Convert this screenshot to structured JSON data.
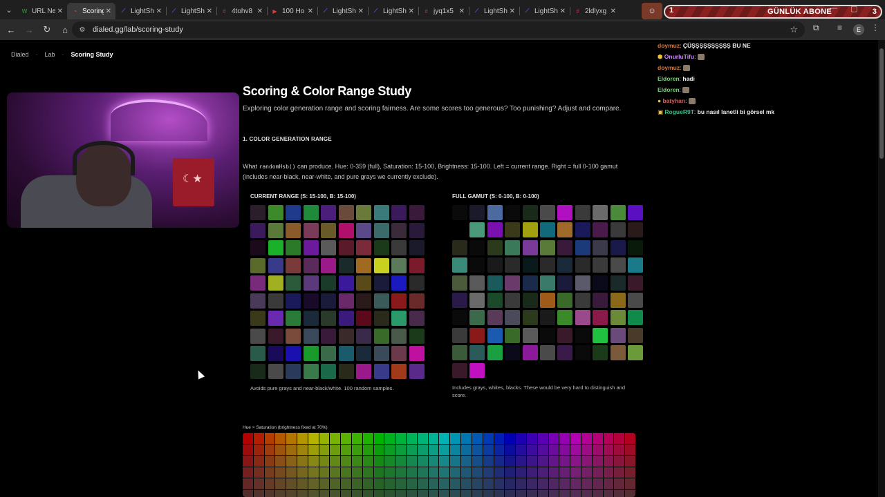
{
  "browser": {
    "tabs": [
      {
        "title": "URL Ne",
        "fav": "W",
        "fav_color": "#2e7d32",
        "active": false
      },
      {
        "title": "Scoring",
        "fav": "◔",
        "fav_color": "#e44d26",
        "active": true
      },
      {
        "title": "LightSh",
        "fav": "⟋",
        "fav_color": "#7b3ff2",
        "active": false
      },
      {
        "title": "LightSh",
        "fav": "⟋",
        "fav_color": "#7b3ff2",
        "active": false
      },
      {
        "title": "4tohv8",
        "fav": "#",
        "fav_color": "#c2185b",
        "active": false
      },
      {
        "title": "100 Ho",
        "fav": "▶",
        "fav_color": "#e53935",
        "active": false
      },
      {
        "title": "LightSh",
        "fav": "⟋",
        "fav_color": "#7b3ff2",
        "active": false
      },
      {
        "title": "LightSh",
        "fav": "⟋",
        "fav_color": "#7b3ff2",
        "active": false
      },
      {
        "title": "jyq1x5",
        "fav": "#",
        "fav_color": "#c2185b",
        "active": false
      },
      {
        "title": "LightSh",
        "fav": "⟋",
        "fav_color": "#7b3ff2",
        "active": false
      },
      {
        "title": "LightSh",
        "fav": "⟋",
        "fav_color": "#7b3ff2",
        "active": false
      },
      {
        "title": "2ldlyxg",
        "fav": "#",
        "fav_color": "#c2185b",
        "active": false
      }
    ],
    "url": "dialed.gg/lab/scoring-study",
    "profile_initial": "E"
  },
  "overlay": {
    "count_left": "1",
    "label": "GÜNLÜK ABONE",
    "count_right": "3"
  },
  "breadcrumb": {
    "items": [
      "Dialed",
      "Lab",
      "Scoring Study"
    ]
  },
  "page": {
    "title": "Scoring & Color Range Study",
    "subtitle": "Exploring color generation range and scoring fairness. Are some scores too generous? Too punishing? Adjust and compare.",
    "section_heading": "1. COLOR GENERATION RANGE",
    "desc_prefix": "What",
    "desc_code": "randomHsb()",
    "desc_suffix": "can produce. Hue: 0-359 (full), Saturation: 15-100, Brightness: 15-100. Left = current range. Right = full 0-100 gamut (includes near-black, near-white, and pure grays we currently exclude).",
    "current_range": {
      "heading": "CURRENT RANGE (S: 15-100, B: 15-100)",
      "note": "Avoids pure grays and near-black/white. 100 random samples."
    },
    "full_gamut": {
      "heading": "FULL GAMUT (S: 0-100, B: 0-100)",
      "note": "Includes grays, whites, blacks. These would be very hard to distinguish and score."
    },
    "hue_sat_label": "Hue × Saturation (brightness fixed at 70%)"
  },
  "swatches_current": [
    "#2a1e2a",
    "#3c8a2a",
    "#1f3a8a",
    "#1e8a3a",
    "#4a1e7a",
    "#6a4a3a",
    "#6a7a3a",
    "#3a7a7a",
    "#3a1a5a",
    "#3a1a3a",
    "#3a1a5a",
    "#5a7a3a",
    "#8a5a2a",
    "#7a3a5a",
    "#6a5a2a",
    "#b0106a",
    "#5a4a8a",
    "#3a6a6a",
    "#3a2a3a",
    "#2a1a3a",
    "#1a0a1a",
    "#1ab02a",
    "#2a7a2a",
    "#6a1a9a",
    "#5a5a5a",
    "#5a1a2a",
    "#7a2a3a",
    "#1a3a1a",
    "#3a3a3a",
    "#1a1a2a",
    "#5a6a2a",
    "#3a3a8a",
    "#7a3a3a",
    "#5a2a5a",
    "#9a1a8a",
    "#1a2a2a",
    "#a06a20",
    "#c8d020",
    "#5a7a5a",
    "#7a1a2a",
    "#7a2a7a",
    "#a0b020",
    "#2a5a3a",
    "#5a3a7a",
    "#1a3a2a",
    "#3a1a9a",
    "#5a4a1a",
    "#1a1a3a",
    "#1a1ac0",
    "#2a2a2a",
    "#4a3a5a",
    "#3a3a3a",
    "#1a1a5a",
    "#1a0a2a",
    "#1a1a3a",
    "#6a2a6a",
    "#2a1a1a",
    "#3a5a5a",
    "#8a1a1a",
    "#6a2a2a",
    "#3a3a1a",
    "#6a2ab0",
    "#2a7a3a",
    "#1a2a3a",
    "#2a3a2a",
    "#3a1a7a",
    "#5a0a1a",
    "#2a2a1a",
    "#2a9a6a",
    "#4a2a4a",
    "#4a4a4a",
    "#3a1a2a",
    "#7a4a3a",
    "#3a4a5a",
    "#3a1a3a",
    "#3a2a2a",
    "#3a2a4a",
    "#3a6a2a",
    "#4a5a4a",
    "#1a3a1a",
    "#2a5a4a",
    "#1a0a5a",
    "#1a10b0",
    "#1a9a2a",
    "#3a6a4a",
    "#1a5a6a",
    "#1a2a3a",
    "#3a4a5a",
    "#6a3a4a",
    "#c010a0",
    "#1a2a1a",
    "#4a4a4a",
    "#2a3a5a",
    "#3a7a4a",
    "#1a6a4a",
    "#2a2a1a",
    "#9a1a8a",
    "#3a3a8a",
    "#a03a1a",
    "#5a2a8a"
  ],
  "swatches_full": [
    "#0a0a0a",
    "#1a1a2a",
    "#4a6aa0",
    "#0a0a0a",
    "#1a2a1a",
    "#4a4a4a",
    "#b010c0",
    "#3a3a3a",
    "#6a6a6a",
    "#4a8a3a",
    "#5a10c0",
    "#000000",
    "#4a9a7a",
    "#7a10b0",
    "#3a3a1a",
    "#a0a010",
    "#106a7a",
    "#a06a2a",
    "#1a1a5a",
    "#4a1a4a",
    "#3a3a3a",
    "#2a1a1a",
    "#2a2a1a",
    "#0a0a0a",
    "#2a3a1a",
    "#3a7a5a",
    "#7a3a9a",
    "#5a7a3a",
    "#3a1a3a",
    "#1a3a7a",
    "#3a3a4a",
    "#1a1a4a",
    "#0a1a0a",
    "#3a8a7a",
    "#0a0a0a",
    "#1a1a1a",
    "#2a2a2a",
    "#0a1a1a",
    "#2a2a2a",
    "#1a2a3a",
    "#2a2a2a",
    "#3a3a3a",
    "#4a4a4a",
    "#1a7a8a",
    "#4a5a3a",
    "#5a5a5a",
    "#1a5a5a",
    "#6a3a6a",
    "#1a2a4a",
    "#3a7a6a",
    "#1a1a3a",
    "#5a5a6a",
    "#0a0a1a",
    "#1a2a2a",
    "#3a1a2a",
    "#2a1a4a",
    "#6a6a6a",
    "#1a4a2a",
    "#3a3a3a",
    "#1a2a1a",
    "#a05a1a",
    "#3a6a2a",
    "#3a3a3a",
    "#3a1a3a",
    "#8a6a1a",
    "#4a4a4a",
    "#0a0a0a",
    "#3a6a4a",
    "#5a3a5a",
    "#4a4a5a",
    "#2a3a1a",
    "#1a1a1a",
    "#3a8a2a",
    "#9a4a8a",
    "#8a1a4a",
    "#6a8a3a",
    "#108a4a",
    "#3a3a3a",
    "#8a1a1a",
    "#1a5ab0",
    "#3a6a2a",
    "#5a5a5a",
    "#0a0a0a",
    "#3a1a2a",
    "#0a0a0a",
    "#20c040",
    "#6a4a7a",
    "#4a3a2a",
    "#3a5a3a",
    "#2a5a5a",
    "#1aa040",
    "#0a0a1a",
    "#8a1a9a",
    "#4a4a4a",
    "#3a1a4a",
    "#0a0a0a",
    "#1a3a1a",
    "#7a5a3a",
    "#6a9a3a",
    "#3a1a2a",
    "#c010c0"
  ],
  "chat": [
    {
      "user": "doymuz",
      "user_color": "#e07a3a",
      "msg": "ÇÜŞŞŞŞŞŞŞŞŞŞ BU NE",
      "badge": ""
    },
    {
      "user": "OnurluTifu",
      "user_color": "#d08aff",
      "msg": "",
      "badge": "⬢"
    },
    {
      "user": "doymuz",
      "user_color": "#e07a3a",
      "msg": "",
      "badge": ""
    },
    {
      "user": "Eldoren",
      "user_color": "#7ad07a",
      "msg": "hadi",
      "badge": ""
    },
    {
      "user": "Eldoren",
      "user_color": "#7ad07a",
      "msg": "",
      "badge": ""
    },
    {
      "user": "batyhan",
      "user_color": "#e05a5a",
      "msg": "",
      "badge": "●"
    },
    {
      "user": "RogueR9T",
      "user_color": "#3ac08a",
      "msg": "bu nasıl lanetli bi görsel mk",
      "badge": "▣"
    }
  ],
  "colors": {
    "accent_active_tab": "#3a3a3a",
    "page_bg": "#000000"
  }
}
